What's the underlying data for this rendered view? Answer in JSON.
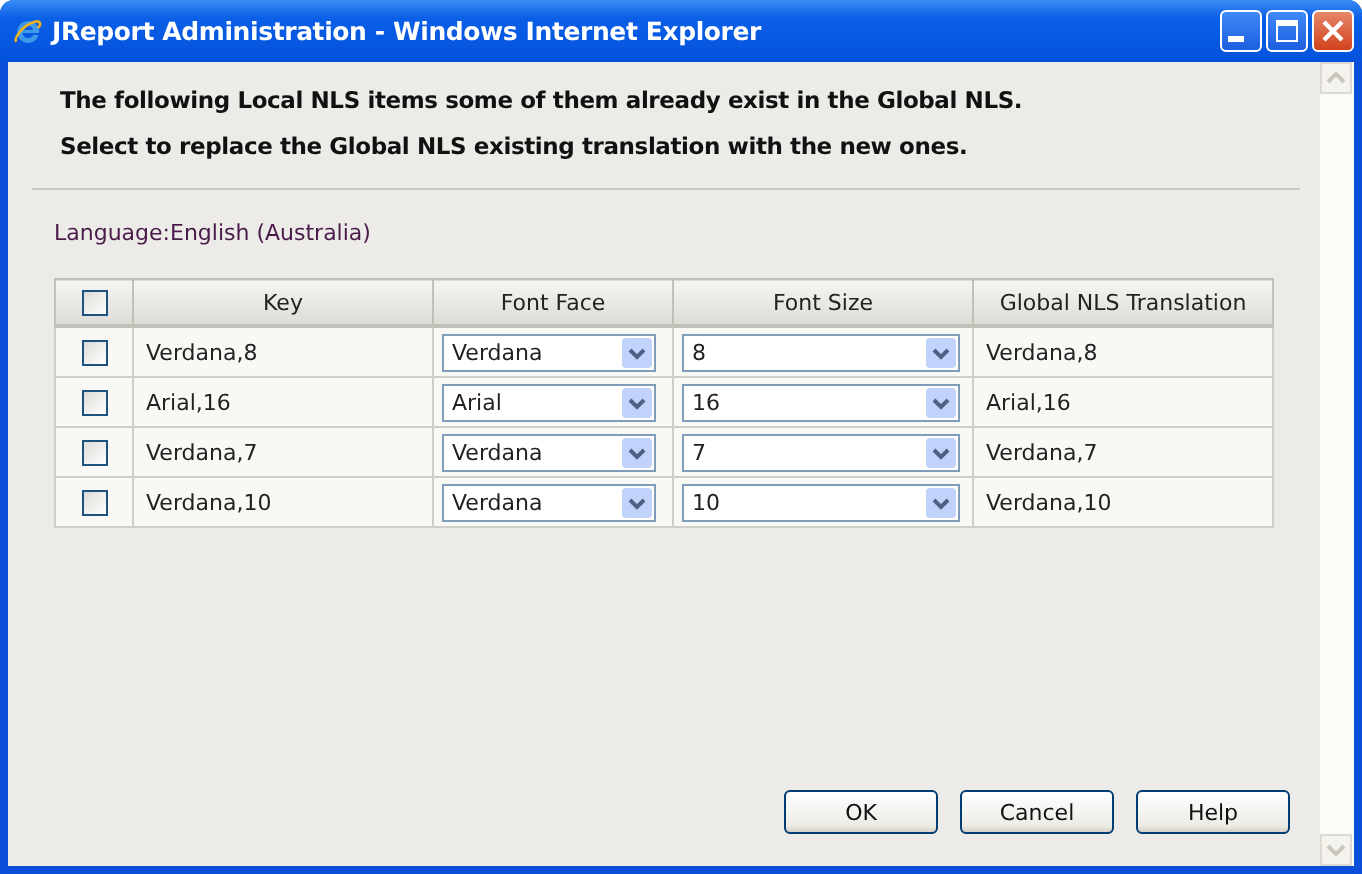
{
  "window": {
    "title": "JReport Administration - Windows Internet Explorer"
  },
  "messages": [
    "The following Local NLS items some of them already exist in the Global NLS.",
    "Select to replace the Global NLS existing translation with the new ones."
  ],
  "language": {
    "label": "Language:",
    "value": "English (Australia)"
  },
  "table": {
    "select_all": {
      "checked": false
    },
    "columns": [
      "Key",
      "Font Face",
      "Font Size",
      "Global NLS Translation"
    ],
    "rows": [
      {
        "checked": false,
        "key": "Verdana,8",
        "font_face": "Verdana",
        "font_size": "8",
        "translation": "Verdana,8"
      },
      {
        "checked": false,
        "key": "Arial,16",
        "font_face": "Arial",
        "font_size": "16",
        "translation": "Arial,16"
      },
      {
        "checked": false,
        "key": "Verdana,7",
        "font_face": "Verdana",
        "font_size": "7",
        "translation": "Verdana,7"
      },
      {
        "checked": false,
        "key": "Verdana,10",
        "font_face": "Verdana",
        "font_size": "10",
        "translation": "Verdana,10"
      }
    ]
  },
  "buttons": [
    "OK",
    "Cancel",
    "Help"
  ]
}
